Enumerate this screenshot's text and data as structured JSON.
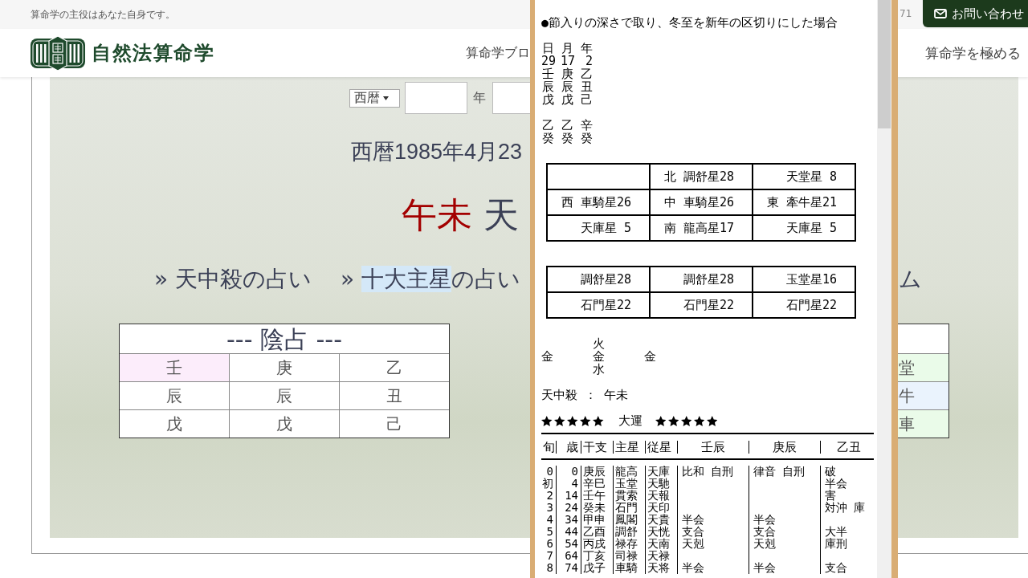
{
  "top_bar": {
    "tagline": "算命学の主役はあなた自身です。",
    "right_text": "71",
    "contact_button": "お問い合わせ"
  },
  "header": {
    "site_name": "自然法算命学",
    "nav": [
      {
        "label": "算命学ブロ"
      },
      {
        "label": "算命学を極める"
      }
    ]
  },
  "date_form": {
    "era": "西暦",
    "unit": "年"
  },
  "date_heading": "西暦1985年4月23",
  "tenchusatsu_heading": [
    {
      "text": "午未",
      "kind": "accent"
    },
    {
      "text": "天",
      "kind": "plain"
    }
  ],
  "links": [
    {
      "segments": [
        {
          "text": "» 天中殺の占い",
          "highlighted": false
        }
      ]
    },
    {
      "segments": [
        {
          "text": "» ",
          "highlighted": false
        },
        {
          "text": "十大主星",
          "highlighted": true
        },
        {
          "text": "の占い",
          "highlighted": false
        }
      ]
    }
  ],
  "link_fragment": "ム",
  "inyo_table": {
    "title": "--- 陰占 ---",
    "rows": [
      {
        "cells": [
          {
            "text": "壬",
            "color": "#fcedfb"
          },
          {
            "text": "庚",
            "color": "#ffffff"
          },
          {
            "text": "乙",
            "color": "#ffffff"
          }
        ]
      },
      {
        "cells": [
          {
            "text": "辰",
            "color": "#ffffff"
          },
          {
            "text": "辰",
            "color": "#ffffff"
          },
          {
            "text": "丑",
            "color": "#ffffff"
          }
        ]
      },
      {
        "cells": [
          {
            "text": "戊",
            "color": "#ffffff"
          },
          {
            "text": "戊",
            "color": "#ffffff"
          },
          {
            "text": "己",
            "color": "#ffffff"
          }
        ]
      }
    ]
  },
  "side_table": {
    "rows": [
      {
        "text": "堂",
        "color": "#eafbe9"
      },
      {
        "text": "牛",
        "color": "#eaf3fd"
      },
      {
        "text": "車",
        "color": "#eafbe9"
      }
    ]
  },
  "popup": {
    "note": "●節入りの深さで取り、冬至を新年の区切りにした場合",
    "pillars": {
      "header": [
        "日",
        "月",
        "年"
      ],
      "rows": [
        [
          "29",
          "17",
          "2"
        ],
        [
          "壬",
          "庚",
          "乙"
        ],
        [
          "辰",
          "辰",
          "丑"
        ],
        [
          "戊",
          "戊",
          "己"
        ]
      ],
      "lower_rows": [
        [
          "乙",
          "乙",
          "辛"
        ],
        [
          "癸",
          "癸",
          "癸"
        ]
      ]
    },
    "star_table": [
      {
        "col_2": "北 調舒星28",
        "col_3": "天堂星 8"
      },
      {
        "col_1": "西 車騎星26",
        "col_2": "中 車騎星26",
        "col_3": "東 牽牛星21"
      },
      {
        "col_1": "天庫星 5",
        "col_2": "南 龍高星17",
        "col_3": "天庫星 5"
      }
    ],
    "star_table_2": [
      {
        "col_1": "調舒星28",
        "col_2": "調舒星28",
        "col_3": "玉堂星16"
      },
      {
        "col_1": "石門星22",
        "col_2": "石門星22",
        "col_3": "石門星22"
      }
    ],
    "five_elements": [
      [
        "金"
      ],
      [
        "火",
        "金",
        "水"
      ],
      [
        "金"
      ]
    ],
    "tenchusatsu": "天中殺 ： 午未",
    "fortune_line": {
      "before": {
        "stars": 5
      },
      "label": "大運",
      "after": {
        "stars": 5
      }
    },
    "luck_table": {
      "columns": [
        "旬",
        "歳",
        "干支",
        "主星",
        "従星",
        "壬辰",
        "庚辰",
        "乙丑"
      ],
      "rows": [
        {
          "col_1": "0",
          "col_2": "0",
          "col_3": "庚辰",
          "col_4": "龍高",
          "col_5": "天庫",
          "col_6": "比和 自刑",
          "col_7": "律音 自刑",
          "col_8": "破"
        },
        {
          "col_1": "初",
          "col_2": "4",
          "col_3": "辛巳",
          "col_4": "玉堂",
          "col_5": "天馳",
          "col_8": "半会"
        },
        {
          "col_1": "2",
          "col_2": "14",
          "col_3": "壬午",
          "col_4": "貫索",
          "col_5": "天報",
          "col_8": "害"
        },
        {
          "col_1": "3",
          "col_2": "24",
          "col_3": "癸未",
          "col_4": "石門",
          "col_5": "天印",
          "col_8": "対沖 庫"
        },
        {
          "col_1": "4",
          "col_2": "34",
          "col_3": "甲申",
          "col_4": "鳳閣",
          "col_5": "天貴",
          "col_6": "半会",
          "col_7": "半会"
        },
        {
          "col_1": "5",
          "col_2": "44",
          "col_3": "乙酉",
          "col_4": "調舒",
          "col_5": "天恍",
          "col_6": "支合",
          "col_7": "支合",
          "col_8": "大半"
        },
        {
          "col_1": "6",
          "col_2": "54",
          "col_3": "丙戌",
          "col_4": "禄存",
          "col_5": "天南",
          "col_6": "天剋",
          "col_7": "天剋",
          "col_8": "庫刑"
        },
        {
          "col_1": "7",
          "col_2": "64",
          "col_3": "丁亥",
          "col_4": "司禄",
          "col_5": "天禄"
        },
        {
          "col_1": "8",
          "col_2": "74",
          "col_3": "戊子",
          "col_4": "車騎",
          "col_5": "天将",
          "col_6": "半会",
          "col_7": "半会",
          "col_8": "支合"
        }
      ]
    }
  }
}
